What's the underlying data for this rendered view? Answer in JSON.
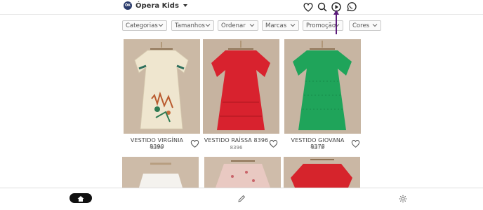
{
  "header": {
    "brand_logo_text": "ÓK",
    "brand_name": "Ópera Kids",
    "icons": [
      "heart-icon",
      "search-icon",
      "play-icon",
      "whatsapp-icon"
    ]
  },
  "filters": [
    {
      "label": "Categorias"
    },
    {
      "label": "Tamanhos"
    },
    {
      "label": "Ordenar"
    },
    {
      "label": "Marcas"
    },
    {
      "label": "Promoção"
    },
    {
      "label": "Cores"
    }
  ],
  "products": [
    {
      "title": "VESTIDO VIRGÍNIA 8390",
      "code": "8390",
      "color": "#efe6cf"
    },
    {
      "title": "VESTIDO RAÍSSA 8396",
      "code": "8396",
      "color": "#d8222e"
    },
    {
      "title": "VESTIDO GIOVANA 8378",
      "code": "8378",
      "color": "#1fa45a"
    },
    {
      "title": "",
      "code": "",
      "color": "#f4f2ee"
    },
    {
      "title": "",
      "code": "",
      "color": "#e9c9c2"
    },
    {
      "title": "",
      "code": "",
      "color": "#d6242c"
    }
  ],
  "bottom_nav": {
    "icons": [
      "home-icon",
      "pencil-icon",
      "gear-icon"
    ]
  },
  "colors": {
    "accent": "#5b1a7a",
    "background": "#c9b8a6"
  }
}
